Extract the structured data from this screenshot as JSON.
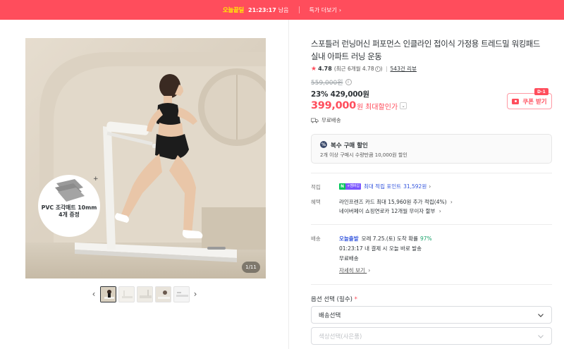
{
  "banner": {
    "brand": "오늘끝딜",
    "time": "21:23:17",
    "remain": "남음",
    "deal_link": "특가 더보기"
  },
  "gallery": {
    "counter": "1/11",
    "promo_title": "PVC 조각매트 10mm",
    "promo_sub": "4개 증정",
    "prev_icon": "chevron-left-icon",
    "next_icon": "chevron-right-icon"
  },
  "product": {
    "title": "스포틀러 런닝머신 퍼포먼스 인클라인 접이식 가정용 트레드밀 워킹패드 실내 아파트 러닝 운동",
    "rating": "4.78",
    "rating_recent": "(최근 6개월 4.78",
    "rating_recent_close": ")",
    "reviews": "543건 리뷰",
    "original_price": "559,000원",
    "discount": "23%",
    "sale_price": "429,000원",
    "best_price": "399,000",
    "best_unit": "원",
    "best_label": "최대할인가",
    "coupon_button": "쿠폰 받기",
    "coupon_tag": "D-1",
    "shipping_free": "무료배송"
  },
  "multi_buy": {
    "title": "복수 구매 할인",
    "desc": "2개 이상 구매시 수량만큼 10,000원 할인"
  },
  "benefits": {
    "point_label": "적립",
    "npay_n": "N",
    "npay_plus": "+멤버십",
    "point_text": "최대 적립 포인트",
    "point_value": "31,592원",
    "benefit_label": "혜택",
    "benefit1": "라인프렌즈 카드 최대 15,960원 추가 적립(4%)",
    "benefit2": "네이버페이 쇼핑연로카 12개월 무이자 할부"
  },
  "delivery": {
    "label": "배송",
    "today": "오늘출발",
    "arrival": "모레 7.25.(토) 도착 확률",
    "prob": "97%",
    "cutoff": "01:23:17 내 결제 시 오늘 바로 발송",
    "free": "무료배송",
    "more": "자세히 보기"
  },
  "options": {
    "label": "옵션 선택 (필수)",
    "required_mark": "*",
    "select1": "배송선택",
    "select2": "색상선택(사은품)"
  },
  "colors": {
    "accent": "#ff4d5c",
    "link_blue": "#3355dd",
    "green": "#1aa36b"
  }
}
